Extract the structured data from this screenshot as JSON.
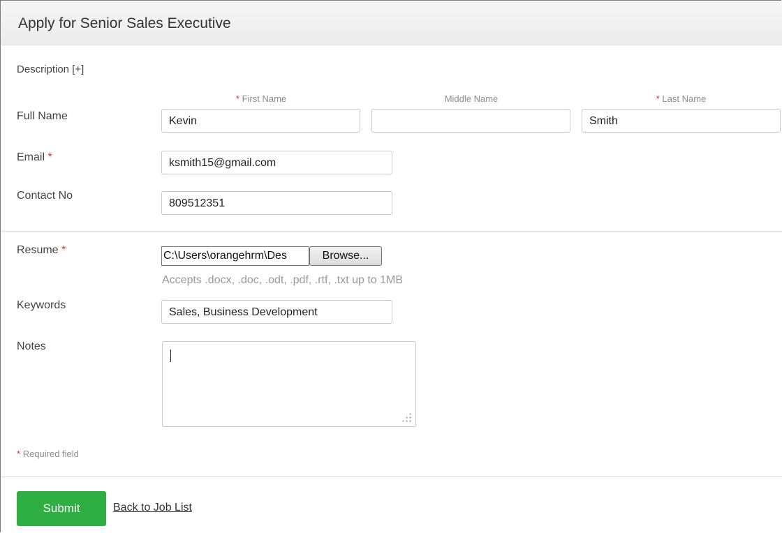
{
  "header": {
    "title": "Apply for Senior Sales Executive"
  },
  "description_toggle": "Description [+]",
  "form": {
    "full_name_label": "Full Name",
    "first_name": {
      "label": "First Name",
      "value": "Kevin",
      "required": true
    },
    "middle_name": {
      "label": "Middle Name",
      "value": ""
    },
    "last_name": {
      "label": "Last Name",
      "value": "Smith",
      "required": true
    },
    "email": {
      "label": "Email",
      "value": "ksmith15@gmail.com",
      "required": true
    },
    "contact": {
      "label": "Contact No",
      "value": "809512351"
    },
    "resume": {
      "label": "Resume",
      "required": true,
      "file_path": "C:\\Users\\orangehrm\\Des",
      "browse_label": "Browse...",
      "hint": "Accepts .docx, .doc, .odt, .pdf, .rtf, .txt up to 1MB"
    },
    "keywords": {
      "label": "Keywords",
      "value": "Sales, Business Development"
    },
    "notes": {
      "label": "Notes",
      "value": ""
    },
    "required_note": "Required field",
    "required_marker": "*"
  },
  "actions": {
    "submit_label": "Submit",
    "back_label": "Back to Job List"
  },
  "colors": {
    "submit": "#2fae44",
    "required_star": "#d9342b"
  }
}
